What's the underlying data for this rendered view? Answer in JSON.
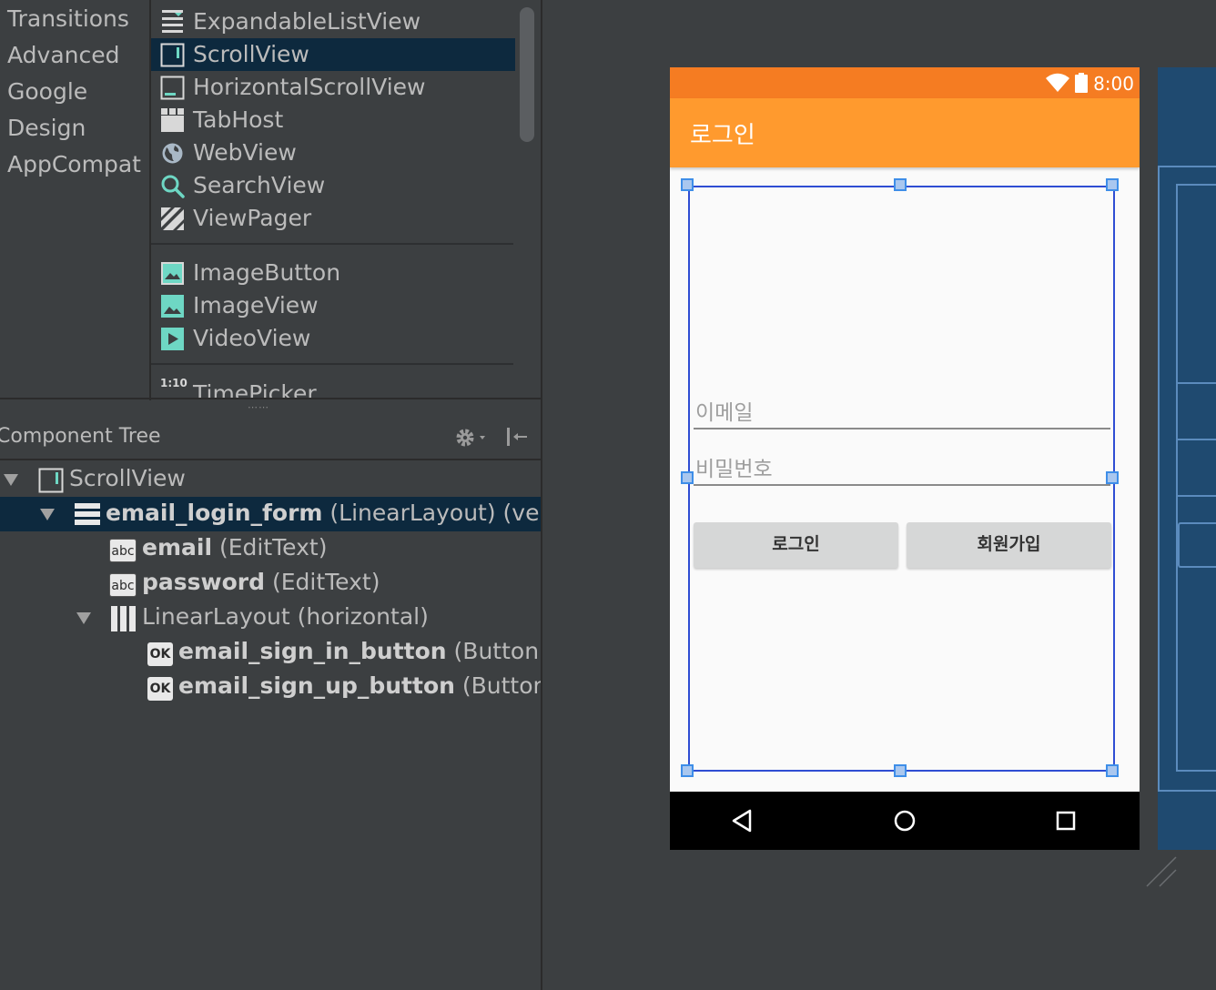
{
  "palette": {
    "categories": [
      "Transitions",
      "Advanced",
      "Google",
      "Design",
      "AppCompat"
    ],
    "widgets": [
      {
        "label": "ExpandableListView",
        "icon": "expandable-list-icon"
      },
      {
        "label": "ScrollView",
        "icon": "scrollview-icon",
        "selected": true
      },
      {
        "label": "HorizontalScrollView",
        "icon": "horizontal-scrollview-icon"
      },
      {
        "label": "TabHost",
        "icon": "tabhost-icon"
      },
      {
        "label": "WebView",
        "icon": "globe-icon"
      },
      {
        "label": "SearchView",
        "icon": "search-icon"
      },
      {
        "label": "ViewPager",
        "icon": "viewpager-icon"
      },
      {
        "label": "ImageButton",
        "icon": "image-icon"
      },
      {
        "label": "ImageView",
        "icon": "image-icon"
      },
      {
        "label": "VideoView",
        "icon": "play-icon"
      },
      {
        "label": "TimePicker",
        "icon": "clock-icon",
        "icon_text": "1:10"
      }
    ]
  },
  "component_tree": {
    "title": "Component Tree",
    "rows": [
      {
        "name": "ScrollView",
        "type": "",
        "icon": "scrollview-icon",
        "expanded": true
      },
      {
        "name": "email_login_form",
        "type": "(LinearLayout) (verti",
        "icon": "vertical-layout-icon",
        "expanded": true,
        "selected": true
      },
      {
        "name": "email",
        "type": "(EditText)",
        "icon": "edittext-icon",
        "badge": "abc"
      },
      {
        "name": "password",
        "type": "(EditText)",
        "icon": "edittext-icon",
        "badge": "abc"
      },
      {
        "name": "LinearLayout",
        "type": "(horizontal)",
        "icon": "horizontal-layout-icon",
        "expanded": true
      },
      {
        "name": "email_sign_in_button",
        "type": "(Button) -",
        "icon": "button-icon",
        "badge": "OK"
      },
      {
        "name": "email_sign_up_button",
        "type": "(Button)",
        "icon": "button-icon",
        "badge": "OK"
      }
    ]
  },
  "device": {
    "status_time": "8:00",
    "app_title": "로그인",
    "email_hint": "이메일",
    "password_hint": "비밀번호",
    "login_button": "로그인",
    "signup_button": "회원가입",
    "colors": {
      "status_bar": "#f57c22",
      "app_bar": "#ff9a2e",
      "selection": "#2f4dd3"
    }
  },
  "colors": {
    "panel_bg": "#3c3f41",
    "selection_bg": "#0d293e",
    "blueprint_bg": "#1f4a70"
  }
}
